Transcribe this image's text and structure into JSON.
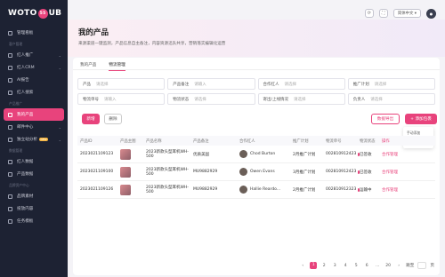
{
  "logo": {
    "pre": "WOTO",
    "dot": "55",
    "post": "UB"
  },
  "sidebar": {
    "items": [
      {
        "label": "管理看板",
        "active": false,
        "arrow": false
      },
      {
        "group": "客户管理"
      },
      {
        "label": "红人推广",
        "active": false,
        "arrow": true
      },
      {
        "label": "红人CRM",
        "active": false,
        "arrow": true
      },
      {
        "label": "AI报告",
        "active": false,
        "arrow": false
      },
      {
        "label": "红人搜索",
        "active": false,
        "arrow": false
      },
      {
        "group": "产品推广"
      },
      {
        "label": "我的产品",
        "active": true,
        "arrow": false
      },
      {
        "label": "邮件中心",
        "active": false,
        "arrow": true
      },
      {
        "label": "独立站分析",
        "active": false,
        "arrow": true,
        "badge": "NEW"
      },
      {
        "group": "数据管理"
      },
      {
        "label": "红人数据",
        "active": false,
        "arrow": false
      },
      {
        "label": "产品数据",
        "active": false,
        "arrow": false
      },
      {
        "group": "品牌资产中心"
      },
      {
        "label": "品牌素材",
        "active": false,
        "arrow": false
      },
      {
        "label": "投放内容",
        "active": false,
        "arrow": false
      },
      {
        "label": "任务模板",
        "active": false,
        "arrow": false
      }
    ]
  },
  "topbar": {
    "lang": "简体中文"
  },
  "header": {
    "title": "我的产品",
    "desc": "来源渠道一键监测，产品信息自主备注，内容资源迅队共享，营销落实编辑化运营"
  },
  "tabs": [
    {
      "label": "我的产品",
      "active": false
    },
    {
      "label": "物流管理",
      "active": true
    }
  ],
  "filters": [
    [
      {
        "label": "产品",
        "ph": "请选择"
      },
      {
        "label": "产品备注",
        "ph": "请输入"
      },
      {
        "label": "合作红人",
        "ph": "请选择"
      },
      {
        "label": "推广计划",
        "ph": "请选择"
      }
    ],
    [
      {
        "label": "物流单号",
        "ph": "请输入"
      },
      {
        "label": "物流状态",
        "ph": "请选择"
      },
      {
        "label": "寄出/上线情况",
        "ph": "请选择"
      },
      {
        "label": "负责人",
        "ph": "请选择"
      }
    ]
  ],
  "actions": {
    "add": "新增",
    "delete": "删除",
    "export": "数据导出",
    "new": "+ 添加包裹"
  },
  "dropdown": [
    "手动添加",
    "批量添加"
  ],
  "table": {
    "headers": [
      "产品ID",
      "产品主图",
      "产品名称",
      "产品备注",
      "合作红人",
      "推广计划",
      "物流单号",
      "物流状态",
      "操作"
    ],
    "rows": [
      {
        "id": "2023021109123",
        "name": "2023新款头型耳机WH-500",
        "note": "优质美国",
        "inf": "Chod Burton",
        "plan": "2月推广计划",
        "track": "002810912423",
        "status": "已签收",
        "op": "合作管理"
      },
      {
        "id": "2023021109100",
        "name": "2023新款头型耳机WH-500",
        "note": "MU9882929",
        "inf": "Owen Evans",
        "plan": "3月推广计划",
        "track": "002810912423",
        "status": "已签收",
        "op": "合作管理"
      },
      {
        "id": "2023021109126",
        "name": "2023新款头型耳机WH-500",
        "note": "MU9882929",
        "inf": "Hallie Reardo...",
        "plan": "2月推广计划",
        "track": "002810912323",
        "status": "运输中",
        "op": "合作管理"
      }
    ]
  },
  "pager": {
    "pages": [
      "1",
      "2",
      "3",
      "4",
      "5",
      "6",
      "...",
      "20"
    ],
    "goto": "跳至",
    "unit": "页"
  }
}
